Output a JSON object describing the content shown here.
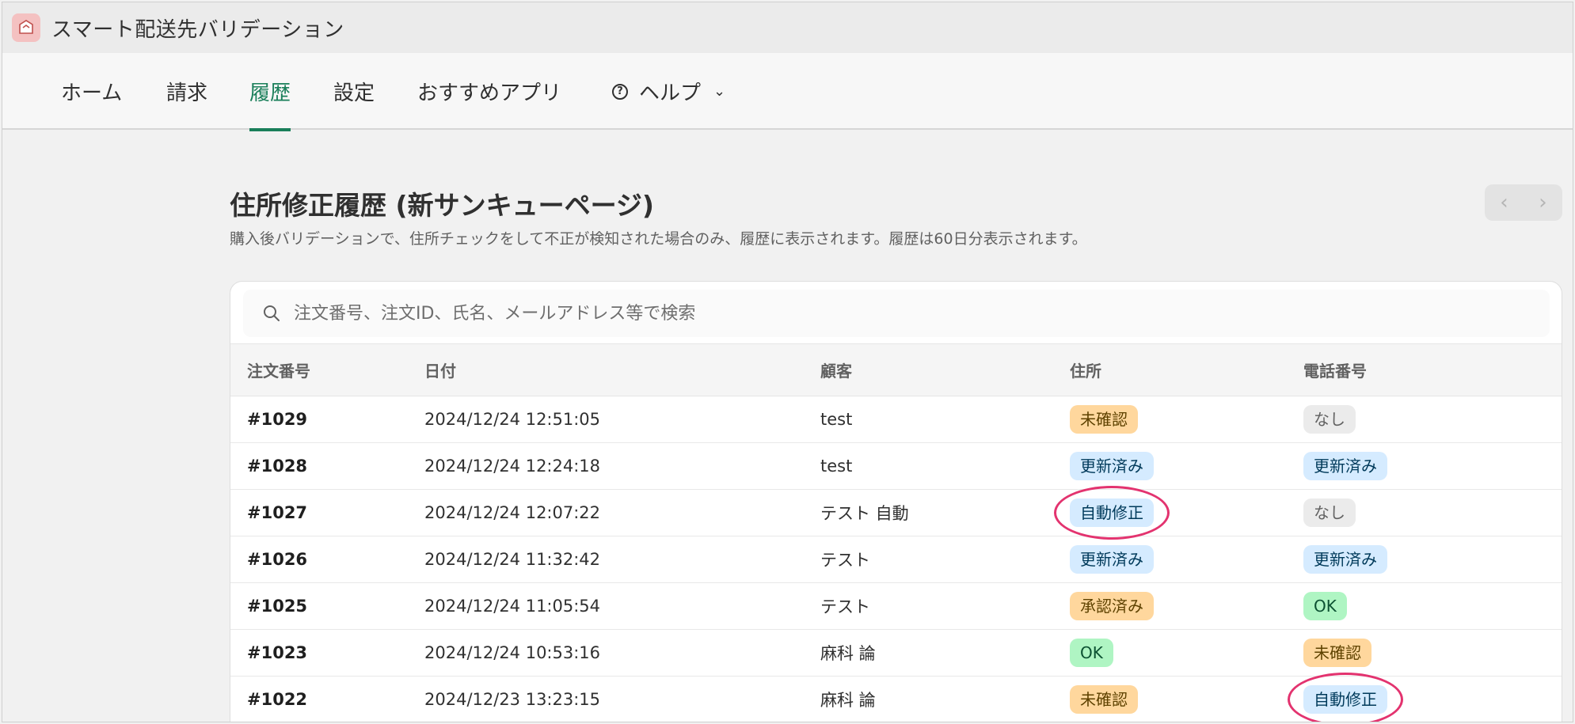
{
  "app": {
    "title": "スマート配送先バリデーション"
  },
  "nav": {
    "items": [
      {
        "label": "ホーム"
      },
      {
        "label": "請求"
      },
      {
        "label": "履歴"
      },
      {
        "label": "設定"
      },
      {
        "label": "おすすめアプリ"
      }
    ],
    "help_label": "ヘルプ",
    "active": "履歴"
  },
  "page": {
    "title": "住所修正履歴 (新サンキューページ)",
    "subtitle": "購入後バリデーションで、住所チェックをして不正が検知された場合のみ、履歴に表示されます。履歴は60日分表示されます。",
    "pager": {
      "prev": "‹",
      "next": "›"
    }
  },
  "search": {
    "placeholder": "注文番号、注文ID、氏名、メールアドレス等で検索",
    "value": ""
  },
  "table": {
    "headers": [
      "注文番号",
      "日付",
      "顧客",
      "住所",
      "電話番号"
    ],
    "rows": [
      {
        "order": "#1029",
        "date": "2024/12/24 12:51:05",
        "customer": "test",
        "address": "未確認",
        "phone": "なし"
      },
      {
        "order": "#1028",
        "date": "2024/12/24 12:24:18",
        "customer": "test",
        "address": "更新済み",
        "phone": "更新済み"
      },
      {
        "order": "#1027",
        "date": "2024/12/24 12:07:22",
        "customer": "テスト 自動",
        "address": "自動修正",
        "phone": "なし"
      },
      {
        "order": "#1026",
        "date": "2024/12/24 11:32:42",
        "customer": "テスト",
        "address": "更新済み",
        "phone": "更新済み"
      },
      {
        "order": "#1025",
        "date": "2024/12/24 11:05:54",
        "customer": "テスト",
        "address": "承認済み",
        "phone": "OK"
      },
      {
        "order": "#1023",
        "date": "2024/12/24 10:53:16",
        "customer": "麻科 論",
        "address": "OK",
        "phone": "未確認"
      },
      {
        "order": "#1022",
        "date": "2024/12/23 13:23:15",
        "customer": "麻科 論",
        "address": "未確認",
        "phone": "自動修正"
      }
    ]
  },
  "status_colors": {
    "未確認": "#ffd79d",
    "承認済み": "#ffd79d",
    "更新済み": "#d5ebff",
    "自動修正": "#d5ebff",
    "なし": "#ebebeb",
    "OK": "#aff5c3"
  },
  "annotation_color": "#e3336f"
}
